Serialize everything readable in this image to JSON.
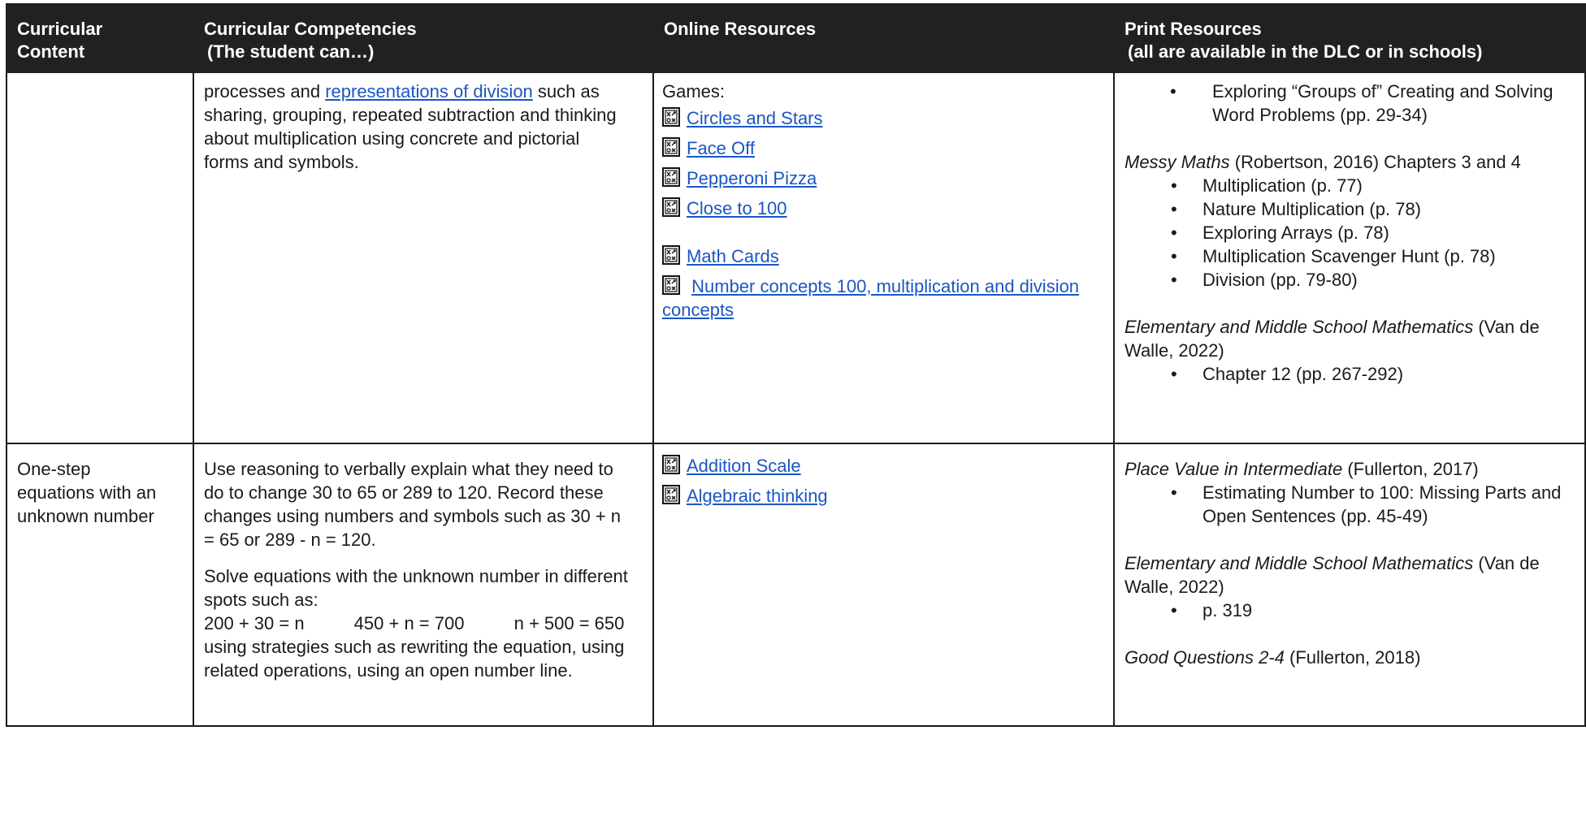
{
  "header": {
    "col1": [
      "Curricular",
      "Content"
    ],
    "col2": [
      "Curricular Competencies",
      "(The student can…)"
    ],
    "col3": "Online Resources",
    "col4": [
      "Print Resources",
      "(all are available in the DLC or in schools)"
    ]
  },
  "row1": {
    "content": "",
    "competency_before": "processes and ",
    "competency_link": "representations of division",
    "competency_after": " such as sharing, grouping, repeated subtraction and thinking about multiplication using concrete and pictorial forms and symbols.",
    "online_heading": "Games:",
    "games": [
      "Circles and Stars",
      "Face Off",
      "Pepperoni Pizza",
      "Close to 100",
      "Math Cards",
      "Number concepts 100, multiplication and division concepts"
    ],
    "print": {
      "bullet_a": "Exploring “Groups of” Creating and Solving Word Problems (pp. 29-34)",
      "book1_title": "Messy Maths",
      "book1_rest": " (Robertson, 2016) Chapters 3 and 4",
      "book1_items": [
        "Multiplication (p. 77)",
        "Nature Multiplication (p. 78)",
        "Exploring Arrays (p. 78)",
        "Multiplication Scavenger Hunt (p. 78)",
        "Division (pp. 79-80)"
      ],
      "book2_title": "Elementary and Middle School Mathematics",
      "book2_rest": " (Van de Walle, 2022)",
      "book2_items": [
        "Chapter 12 (pp. 267-292)"
      ]
    }
  },
  "row2": {
    "content": "One-step equations with an unknown number",
    "competency_p1": "Use reasoning to verbally explain what they need to do to change 30 to 65 or 289 to 120. Record these changes using numbers and symbols such as 30 + n = 65 or 289 - n = 120.",
    "competency_p2a": "Solve equations with the unknown number in different spots such as:",
    "competency_eq": "200 + 30 = n          450 + n = 700          n + 500 = 650",
    "competency_p2b": "using strategies such as rewriting the equation, using related operations, using an open number line.",
    "games": [
      "Addition Scale",
      "Algebraic thinking"
    ],
    "print": {
      "book1_title": "Place Value in Intermediate",
      "book1_rest": " (Fullerton, 2017)",
      "book1_items": [
        "Estimating Number to 100: Missing Parts and Open Sentences (pp. 45-49)"
      ],
      "book2_title": "Elementary and Middle School Mathematics",
      "book2_rest": " (Van de Walle, 2022)",
      "book2_items": [
        "p. 319"
      ],
      "book3_title": "Good Questions 2-4",
      "book3_rest": " (Fullerton, 2018)"
    }
  }
}
